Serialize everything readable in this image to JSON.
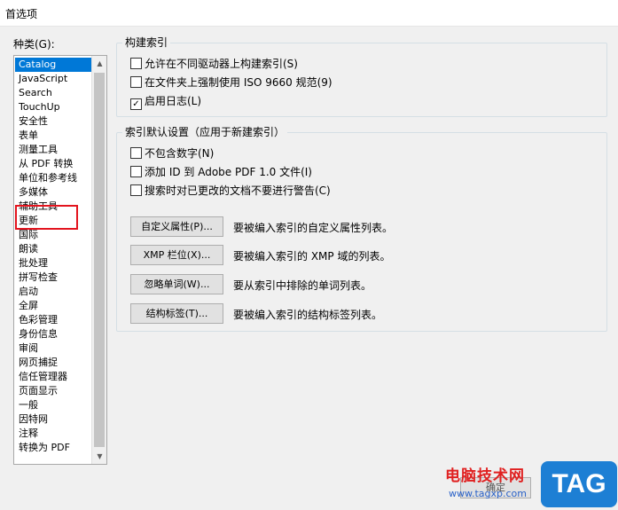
{
  "window": {
    "title": "首选项"
  },
  "categories": {
    "label": "种类(G):",
    "items": [
      "Catalog",
      "JavaScript",
      "Search",
      "TouchUp",
      "安全性",
      "表单",
      "测量工具",
      "从 PDF 转换",
      "单位和参考线",
      "多媒体",
      "辅助工具",
      "更新",
      "国际",
      "朗读",
      "批处理",
      "拼写检查",
      "启动",
      "全屏",
      "色彩管理",
      "身份信息",
      "审阅",
      "网页捕捉",
      "信任管理器",
      "页面显示",
      "一般",
      "因特网",
      "注释",
      "转换为 PDF"
    ],
    "selected": "Catalog"
  },
  "build_index": {
    "title": "构建索引",
    "options": [
      {
        "label": "允许在不同驱动器上构建索引(S)",
        "checked": false
      },
      {
        "label": "在文件夹上强制使用 ISO 9660 规范(9)",
        "checked": false
      },
      {
        "label": "启用日志(L)",
        "checked": true
      }
    ]
  },
  "index_defaults": {
    "title": "索引默认设置（应用于新建索引）",
    "options": [
      {
        "label": "不包含数字(N)",
        "checked": false
      },
      {
        "label": "添加 ID 到 Adobe PDF 1.0 文件(I)",
        "checked": false
      },
      {
        "label": "搜索时对已更改的文档不要进行警告(C)",
        "checked": false
      }
    ],
    "buttons": [
      {
        "label": "自定义属性(P)...",
        "desc": "要被编入索引的自定义属性列表。"
      },
      {
        "label": "XMP 栏位(X)...",
        "desc": "要被编入索引的 XMP 域的列表。"
      },
      {
        "label": "忽略单词(W)...",
        "desc": "要从索引中排除的单词列表。"
      },
      {
        "label": "结构标签(T)...",
        "desc": "要被编入索引的结构标签列表。"
      }
    ]
  },
  "footer": {
    "ok_label": "确定"
  },
  "watermark": {
    "site_name": "电脑技术网",
    "site_url": "www.tagxp.com",
    "logo": "TAG"
  },
  "colors": {
    "selection": "#0078d7",
    "highlight_box": "#e3141e"
  },
  "icons": {
    "scroll_up": "chevron-up-icon",
    "scroll_down": "chevron-down-icon",
    "check": "checkmark-icon"
  }
}
